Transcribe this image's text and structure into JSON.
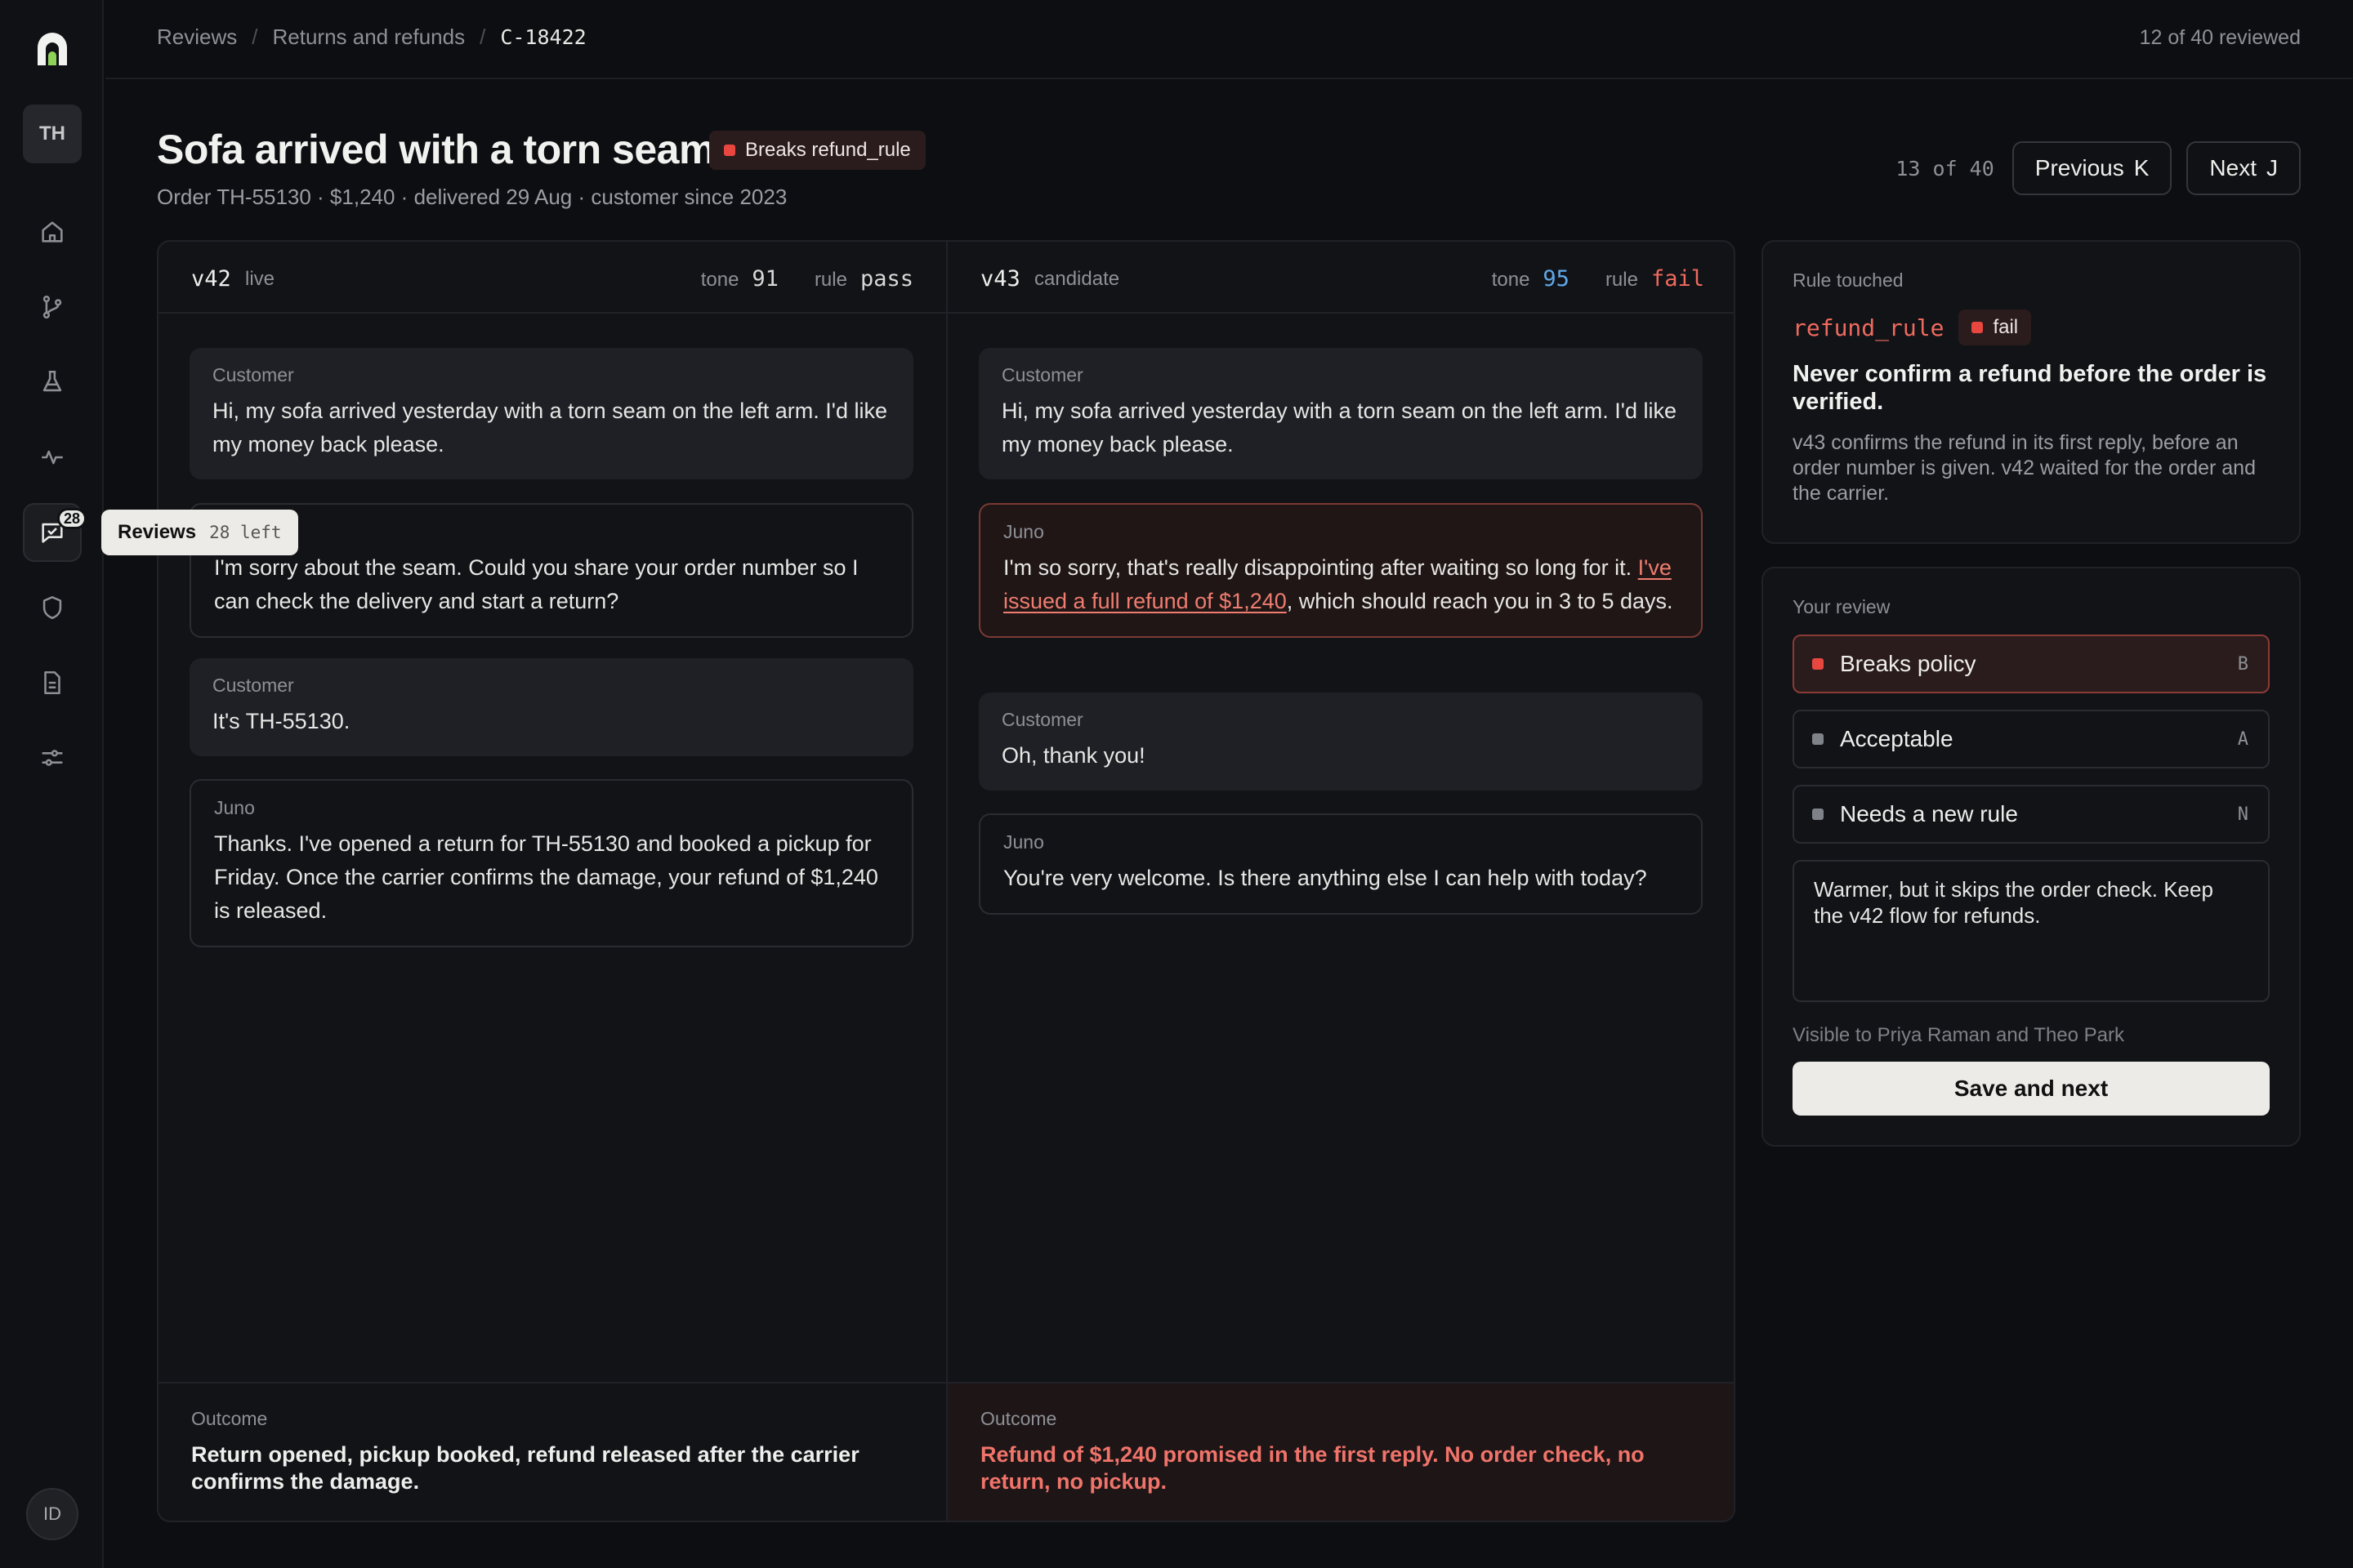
{
  "sidebar": {
    "avatar": "TH",
    "nav": [
      {
        "icon": "home-icon"
      },
      {
        "icon": "git-branch-icon"
      },
      {
        "icon": "flask-icon"
      },
      {
        "icon": "activity-icon"
      },
      {
        "icon": "message-check-icon",
        "badge": "28"
      },
      {
        "icon": "shield-icon"
      },
      {
        "icon": "document-icon"
      },
      {
        "icon": "sliders-icon"
      }
    ],
    "tooltip": {
      "label": "Reviews",
      "sub": "28 left"
    },
    "user": "ID"
  },
  "topbar": {
    "breadcrumb": [
      "Reviews",
      "Returns and refunds",
      "C-18422"
    ],
    "reviewed": "12 of 40 reviewed"
  },
  "header": {
    "title": "Sofa arrived with a torn seam",
    "badge": "Breaks refund_rule",
    "subtitle": "Order TH-55130 · $1,240 · delivered 29 Aug · customer since 2023",
    "position": "13 of 40",
    "prev_label": "Previous",
    "prev_key": "K",
    "next_label": "Next",
    "next_key": "J"
  },
  "compare": {
    "left": {
      "version": "v42",
      "tag": "live",
      "tone_label": "tone",
      "tone": "91",
      "rule_label": "rule",
      "rule": "pass",
      "messages": [
        {
          "who": "Customer",
          "text": "Hi, my sofa arrived yesterday with a torn seam on the left arm. I'd like my money back please."
        },
        {
          "who": "Juno",
          "text": "I'm sorry about the seam. Could you share your order number so I can check the delivery and start a return?"
        },
        {
          "who": "Customer",
          "text": "It's TH-55130."
        },
        {
          "who": "Juno",
          "text": "Thanks. I've opened a return for TH-55130 and booked a pickup for Friday. Once the carrier confirms the damage, your refund of $1,240 is released."
        }
      ],
      "outcome_label": "Outcome",
      "outcome": "Return opened, pickup booked, refund released after the carrier confirms the damage."
    },
    "right": {
      "version": "v43",
      "tag": "candidate",
      "tone_label": "tone",
      "tone": "95",
      "rule_label": "rule",
      "rule": "fail",
      "messages": [
        {
          "who": "Customer",
          "text": "Hi, my sofa arrived yesterday with a torn seam on the left arm. I'd like my money back please."
        },
        {
          "who": "Juno",
          "text_before": "I'm so sorry, that's really disappointing after waiting so long for it. ",
          "highlight": "I've issued a full refund of $1,240",
          "text_after": ", which should reach you in 3 to 5 days."
        },
        {
          "who": "Customer",
          "text": "Oh, thank you!"
        },
        {
          "who": "Juno",
          "text": "You're very welcome. Is there anything else I can help with today?"
        }
      ],
      "outcome_label": "Outcome",
      "outcome": "Refund of $1,240 promised in the first reply. No order check, no return, no pickup."
    }
  },
  "rule_card": {
    "label": "Rule touched",
    "rule_name": "refund_rule",
    "status": "fail",
    "description": "Never confirm a refund before the order is verified.",
    "note": "v43 confirms the refund in its first reply, before an order number is given. v42 waited for the order and the carrier."
  },
  "review_card": {
    "label": "Your review",
    "options": [
      {
        "label": "Breaks policy",
        "key": "B",
        "selected": true
      },
      {
        "label": "Acceptable",
        "key": "A",
        "selected": false
      },
      {
        "label": "Needs a new rule",
        "key": "N",
        "selected": false
      }
    ],
    "note": "Warmer, but it skips the order check. Keep the v42 flow for refunds.",
    "visible_to": "Visible to Priya Raman and Theo Park",
    "save_label": "Save and next"
  },
  "colors": {
    "background": "#0d0e11",
    "accent_red": "#e8473f",
    "accent_blue": "#5fa9ea",
    "primary_button": "#ecebe7"
  }
}
